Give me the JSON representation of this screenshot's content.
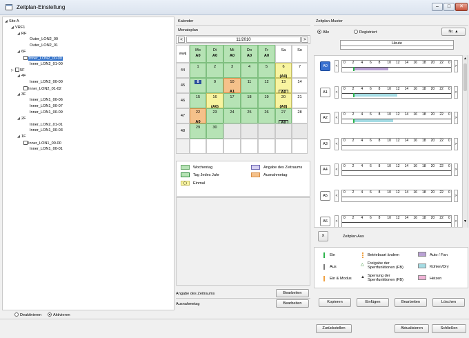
{
  "window": {
    "title": "Zeitplan-Einstellung"
  },
  "tree": {
    "nodes": [
      {
        "label": "Site A",
        "level": 0,
        "arrow": "down",
        "cal": false
      },
      {
        "label": "VRF1",
        "level": 1,
        "arrow": "down",
        "cal": false
      },
      {
        "label": "RF",
        "level": 2,
        "arrow": "down",
        "cal": false
      },
      {
        "label": "Outer_LON2_00",
        "level": 4,
        "arrow": "",
        "cal": false
      },
      {
        "label": "Outer_LON2_01",
        "level": 4,
        "arrow": "",
        "cal": false
      },
      {
        "label": "6F",
        "level": 2,
        "arrow": "down",
        "cal": false
      },
      {
        "label": "Inner_LON2_00-00",
        "level": 3,
        "arrow": "",
        "cal": true,
        "selected": true
      },
      {
        "label": "Inner_LON2_01-00",
        "level": 4,
        "arrow": "",
        "cal": false
      },
      {
        "label": "5F",
        "level": 1,
        "arrow": "right",
        "cal": true
      },
      {
        "label": "4F",
        "level": 2,
        "arrow": "down",
        "cal": false
      },
      {
        "label": "Inner_LON2_00-00",
        "level": 4,
        "arrow": "",
        "cal": false
      },
      {
        "label": "Inner_LON2_01-02",
        "level": 3,
        "arrow": "",
        "cal": true
      },
      {
        "label": "3F",
        "level": 2,
        "arrow": "down",
        "cal": false
      },
      {
        "label": "Inner_LON1_00-06",
        "level": 4,
        "arrow": "",
        "cal": false
      },
      {
        "label": "Inner_LON1_00-07",
        "level": 4,
        "arrow": "",
        "cal": false
      },
      {
        "label": "Inner_LON1_00-09",
        "level": 4,
        "arrow": "",
        "cal": false
      },
      {
        "label": "2F",
        "level": 2,
        "arrow": "down",
        "cal": false
      },
      {
        "label": "Inner_LON2_01-01",
        "level": 4,
        "arrow": "",
        "cal": false
      },
      {
        "label": "Inner_LON1_00-03",
        "level": 4,
        "arrow": "",
        "cal": false
      },
      {
        "label": "1F",
        "level": 2,
        "arrow": "down",
        "cal": false
      },
      {
        "label": "Inner_LON1_00-00",
        "level": 3,
        "arrow": "",
        "cal": true
      },
      {
        "label": "Inner_LON1_00-01",
        "level": 4,
        "arrow": "",
        "cal": false
      }
    ],
    "mode": {
      "deactivate": "Deaktivieren",
      "activate": "Aktivieren",
      "selected": "activate"
    }
  },
  "calendar": {
    "section": "Kalender",
    "subsection": "Monatsplan",
    "month": "11/2010",
    "weekcol": "wwij",
    "days": [
      {
        "d": "Mo",
        "t": "A0"
      },
      {
        "d": "Di",
        "t": "A0"
      },
      {
        "d": "Mi",
        "t": "A0"
      },
      {
        "d": "Do",
        "t": "A0"
      },
      {
        "d": "Fr",
        "t": "A0"
      },
      {
        "d": "Sa",
        "t": ""
      },
      {
        "d": "So",
        "t": ""
      }
    ],
    "weeks": [
      {
        "wk": "44",
        "cells": [
          {
            "n": "1",
            "c": "green"
          },
          {
            "n": "2",
            "c": "green"
          },
          {
            "n": "3",
            "c": "green"
          },
          {
            "n": "4",
            "c": "green"
          },
          {
            "n": "5",
            "c": "green"
          },
          {
            "n": "6",
            "c": "yellow",
            "t": "(A0)"
          },
          {
            "n": "7",
            "c": ""
          }
        ]
      },
      {
        "wk": "45",
        "cells": [
          {
            "n": "8",
            "c": "green",
            "box": true
          },
          {
            "n": "9",
            "c": "green"
          },
          {
            "n": "10",
            "c": "orange",
            "t": "A1"
          },
          {
            "n": "11",
            "c": "green"
          },
          {
            "n": "12",
            "c": "green"
          },
          {
            "n": "13",
            "c": "yellow",
            "t": "A0",
            "tbox": true
          },
          {
            "n": "14",
            "c": ""
          }
        ]
      },
      {
        "wk": "46",
        "cells": [
          {
            "n": "15",
            "c": "green"
          },
          {
            "n": "16",
            "c": "yellow",
            "t": "(A0)"
          },
          {
            "n": "17",
            "c": "green"
          },
          {
            "n": "18",
            "c": "green"
          },
          {
            "n": "19",
            "c": "green"
          },
          {
            "n": "20",
            "c": "yellow",
            "t": "(A0)"
          },
          {
            "n": "21",
            "c": ""
          }
        ]
      },
      {
        "wk": "47",
        "cells": [
          {
            "n": "22",
            "c": "orange",
            "t": "A0"
          },
          {
            "n": "23",
            "c": "green"
          },
          {
            "n": "24",
            "c": "green"
          },
          {
            "n": "25",
            "c": "green"
          },
          {
            "n": "26",
            "c": "green"
          },
          {
            "n": "27",
            "c": "green",
            "t": "A0",
            "tbox": true
          },
          {
            "n": "28",
            "c": ""
          }
        ]
      },
      {
        "wk": "48",
        "cells": [
          {
            "n": "29",
            "c": "green"
          },
          {
            "n": "30",
            "c": "green"
          },
          {
            "n": "",
            "c": "gray"
          },
          {
            "n": "",
            "c": "gray"
          },
          {
            "n": "",
            "c": "gray"
          },
          {
            "n": "",
            "c": "gray"
          },
          {
            "n": "",
            "c": "gray"
          }
        ]
      },
      {
        "wk": "",
        "cells": [
          {
            "n": "",
            "c": ""
          },
          {
            "n": "",
            "c": ""
          },
          {
            "n": "",
            "c": ""
          },
          {
            "n": "",
            "c": ""
          },
          {
            "n": "",
            "c": ""
          },
          {
            "n": "",
            "c": ""
          },
          {
            "n": "",
            "c": ""
          }
        ]
      }
    ],
    "legend": {
      "weekday": "Wochentag",
      "period": "Angabe des Zeitraums",
      "yearly": "Tag Jedes Jahr",
      "exception": "Ausnahmetag",
      "once": "Einmal"
    },
    "period_row": "Angabe des Zeitraums",
    "exception_row": "Ausnahmetag",
    "edit": "Bearbeiten"
  },
  "pattern": {
    "section": "Zeitplan-Muster",
    "filter_all": "Alle",
    "filter_registered": "Registriert",
    "sort_btn": "Nr. ▲",
    "today": "Heute",
    "hours": [
      "0",
      "2",
      "4",
      "6",
      "8",
      "10",
      "12",
      "14",
      "16",
      "18",
      "20",
      "22",
      "0"
    ],
    "rows": [
      {
        "id": "A0",
        "selected": true
      },
      {
        "id": "A1",
        "selected": false
      },
      {
        "id": "A2",
        "selected": false
      },
      {
        "id": "A3",
        "selected": false
      },
      {
        "id": "A4",
        "selected": false
      },
      {
        "id": "A5",
        "selected": false
      },
      {
        "id": "A6",
        "selected": false
      }
    ],
    "off_btn": "X",
    "off_label": "Zeitplan Aus",
    "legend": {
      "on": "Ein",
      "off": "Aus",
      "on_mode": "Ein & Modus",
      "change_op": "Betriebsart ändern",
      "lock_enable": "Freigabe der Sperrfunktionen (FB)",
      "lock": "Sperrung der Sperrfunktionen (FB)",
      "auto_fan": "Auto / Fan",
      "cool_dry": "Kühlen/Dry",
      "heat": "Heizen"
    },
    "colors": {
      "auto_fan": "#b9a1d4",
      "cool_dry": "#a5dce4",
      "heat": "#f0b3d6",
      "on": "#2bb34a",
      "off": "#7a7a7a",
      "on_mode": "#f0a040"
    },
    "buttons": {
      "copy": "Kopieren",
      "paste": "Einfügen",
      "edit": "Bearbeiten",
      "delete": "Löschen"
    }
  },
  "footer": {
    "reset": "Zurückstellen",
    "update": "Aktualisieren",
    "close": "Schließen"
  }
}
